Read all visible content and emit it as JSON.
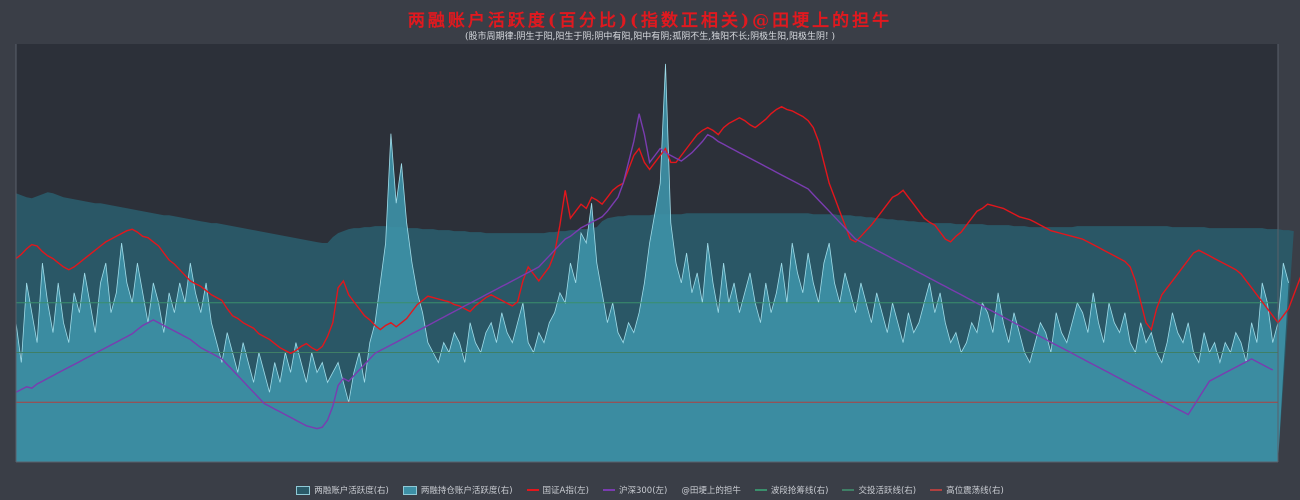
{
  "chart_data": {
    "type": "line",
    "title": "两融账户活跃度(百分比)(指数正相关)@田埂上的担牛",
    "subtitle": "(股市周期律:阴生于阳,阳生于阴;阴中有阳,阳中有阴;孤阴不生,独阳不长;阴极生阳,阳极生阴! )",
    "xlabel": "",
    "ylabel": "",
    "grid": false,
    "legend_position": "bottom",
    "x_points": 240,
    "series": [
      {
        "name": "两融账户活跃度(右)",
        "axis": "right",
        "kind": "area",
        "color": "#2a5a68",
        "values": [
          27.0,
          26.8,
          26.6,
          26.5,
          26.7,
          26.9,
          27.1,
          27.0,
          26.8,
          26.6,
          26.5,
          26.4,
          26.3,
          26.2,
          26.1,
          26.0,
          26.0,
          25.9,
          25.8,
          25.7,
          25.6,
          25.5,
          25.4,
          25.3,
          25.2,
          25.1,
          25.0,
          24.9,
          24.8,
          24.8,
          24.7,
          24.6,
          24.5,
          24.4,
          24.3,
          24.2,
          24.1,
          24.0,
          24.0,
          23.9,
          23.8,
          23.7,
          23.6,
          23.5,
          23.4,
          23.3,
          23.2,
          23.1,
          23.0,
          22.9,
          22.8,
          22.7,
          22.6,
          22.5,
          22.4,
          22.3,
          22.2,
          22.1,
          22.0,
          22.0,
          22.6,
          23.0,
          23.2,
          23.4,
          23.5,
          23.5,
          23.6,
          23.6,
          23.7,
          23.7,
          23.7,
          23.6,
          23.6,
          23.6,
          23.5,
          23.5,
          23.5,
          23.4,
          23.4,
          23.4,
          23.3,
          23.3,
          23.3,
          23.2,
          23.2,
          23.2,
          23.1,
          23.1,
          23.1,
          23.0,
          23.0,
          23.0,
          23.0,
          23.0,
          23.0,
          23.0,
          23.0,
          23.0,
          23.0,
          23.0,
          23.0,
          23.1,
          23.1,
          23.2,
          23.2,
          23.3,
          23.3,
          23.4,
          23.4,
          23.5,
          23.6,
          24.2,
          24.5,
          24.6,
          24.7,
          24.7,
          24.8,
          24.8,
          24.8,
          24.8,
          24.8,
          24.9,
          24.9,
          24.9,
          24.9,
          24.9,
          24.9,
          25.0,
          25.0,
          25.0,
          25.0,
          25.0,
          25.0,
          25.0,
          25.0,
          25.0,
          25.0,
          25.0,
          25.0,
          25.0,
          25.0,
          25.0,
          25.0,
          25.0,
          25.0,
          25.0,
          25.0,
          25.0,
          25.0,
          25.0,
          25.0,
          24.9,
          24.9,
          24.9,
          24.9,
          24.9,
          24.8,
          24.8,
          24.8,
          24.7,
          24.7,
          24.6,
          24.6,
          24.5,
          24.5,
          24.4,
          24.4,
          24.3,
          24.3,
          24.2,
          24.2,
          24.1,
          24.1,
          24.0,
          24.0,
          24.0,
          24.0,
          24.0,
          23.9,
          23.9,
          23.9,
          23.9,
          23.9,
          23.9,
          23.8,
          23.8,
          23.8,
          23.8,
          23.8,
          23.7,
          23.7,
          23.7,
          23.6,
          23.6,
          23.6,
          23.6,
          23.6,
          23.6,
          23.6,
          23.6,
          23.6,
          23.7,
          23.7,
          23.7,
          23.7,
          23.7,
          23.7,
          23.7,
          23.7,
          23.7,
          23.7,
          23.7,
          23.7,
          23.7,
          23.7,
          23.7,
          23.7,
          23.7,
          23.7,
          23.6,
          23.6,
          23.6,
          23.6,
          23.6,
          23.6,
          23.6,
          23.5,
          23.5,
          23.5,
          23.5,
          23.5,
          23.5,
          23.5,
          23.5,
          23.5,
          23.5,
          23.5,
          23.4,
          23.4,
          23.4,
          23.3,
          23.3,
          23.2
        ]
      },
      {
        "name": "两融持仓账户活跃度(右)",
        "axis": "right",
        "kind": "area",
        "color": "#3d90a6",
        "values": [
          14.0,
          10.0,
          18.0,
          15.0,
          12.0,
          20.0,
          16.0,
          13.0,
          18.0,
          14.0,
          12.0,
          17.0,
          15.0,
          19.0,
          16.0,
          13.0,
          18.0,
          20.0,
          15.0,
          17.0,
          22.0,
          18.0,
          16.0,
          20.0,
          17.0,
          14.0,
          18.0,
          16.0,
          13.0,
          17.0,
          15.0,
          18.0,
          16.0,
          20.0,
          17.0,
          15.0,
          18.0,
          14.0,
          12.0,
          10.0,
          13.0,
          11.0,
          9.0,
          12.0,
          10.0,
          8.0,
          11.0,
          9.0,
          7.0,
          10.0,
          8.0,
          11.0,
          9.0,
          12.0,
          10.0,
          8.0,
          11.0,
          9.0,
          10.0,
          8.0,
          9.0,
          10.0,
          8.0,
          6.0,
          9.0,
          11.0,
          8.0,
          12.0,
          14.0,
          18.0,
          22.0,
          33.0,
          26.0,
          30.0,
          24.0,
          20.0,
          17.0,
          15.0,
          12.0,
          11.0,
          10.0,
          12.0,
          11.0,
          13.0,
          12.0,
          10.0,
          14.0,
          12.0,
          11.0,
          13.0,
          14.0,
          12.0,
          15.0,
          13.0,
          12.0,
          14.0,
          16.0,
          12.0,
          11.0,
          13.0,
          12.0,
          14.0,
          15.0,
          17.0,
          16.0,
          20.0,
          18.0,
          23.0,
          22.0,
          26.0,
          20.0,
          17.0,
          14.0,
          16.0,
          13.0,
          12.0,
          14.0,
          13.0,
          15.0,
          18.0,
          22.0,
          25.0,
          28.0,
          40.0,
          24.0,
          20.0,
          18.0,
          21.0,
          17.0,
          19.0,
          16.0,
          22.0,
          18.0,
          15.0,
          20.0,
          16.0,
          18.0,
          15.0,
          17.0,
          19.0,
          16.0,
          14.0,
          18.0,
          15.0,
          17.0,
          20.0,
          16.0,
          22.0,
          19.0,
          17.0,
          21.0,
          18.0,
          16.0,
          20.0,
          22.0,
          18.0,
          16.0,
          19.0,
          17.0,
          15.0,
          18.0,
          16.0,
          14.0,
          17.0,
          15.0,
          13.0,
          16.0,
          14.0,
          12.0,
          15.0,
          13.0,
          14.0,
          16.0,
          18.0,
          15.0,
          17.0,
          14.0,
          12.0,
          13.0,
          11.0,
          12.0,
          14.0,
          13.0,
          16.0,
          15.0,
          13.0,
          17.0,
          14.0,
          12.0,
          15.0,
          13.0,
          11.0,
          10.0,
          12.0,
          14.0,
          13.0,
          11.0,
          15.0,
          13.0,
          12.0,
          14.0,
          16.0,
          15.0,
          13.0,
          17.0,
          14.0,
          12.0,
          16.0,
          14.0,
          13.0,
          15.0,
          12.0,
          11.0,
          14.0,
          12.0,
          13.0,
          11.0,
          10.0,
          12.0,
          15.0,
          13.0,
          12.0,
          14.0,
          11.0,
          10.0,
          13.0,
          11.0,
          12.0,
          10.0,
          12.0,
          11.0,
          13.0,
          12.0,
          10.0,
          14.0,
          12.0,
          18.0,
          16.0,
          12.0,
          14.0,
          20.0,
          18.0
        ]
      },
      {
        "name": "国证A指(左)",
        "axis": "left",
        "kind": "line",
        "color": "#e3161c",
        "values": [
          3260,
          3290,
          3330,
          3360,
          3350,
          3310,
          3280,
          3260,
          3230,
          3200,
          3180,
          3200,
          3230,
          3260,
          3290,
          3320,
          3350,
          3380,
          3400,
          3420,
          3440,
          3460,
          3470,
          3450,
          3420,
          3410,
          3380,
          3350,
          3300,
          3250,
          3220,
          3180,
          3140,
          3100,
          3080,
          3060,
          3030,
          3000,
          2980,
          2960,
          2900,
          2850,
          2830,
          2800,
          2780,
          2760,
          2720,
          2700,
          2680,
          2650,
          2620,
          2600,
          2580,
          2600,
          2630,
          2650,
          2620,
          2600,
          2630,
          2700,
          2800,
          3050,
          3100,
          3000,
          2950,
          2900,
          2850,
          2820,
          2780,
          2750,
          2780,
          2800,
          2770,
          2800,
          2830,
          2880,
          2930,
          2960,
          2990,
          2980,
          2970,
          2960,
          2950,
          2930,
          2920,
          2900,
          2880,
          2920,
          2950,
          2980,
          3000,
          2980,
          2960,
          2940,
          2920,
          2950,
          3100,
          3200,
          3150,
          3100,
          3150,
          3200,
          3300,
          3500,
          3750,
          3550,
          3600,
          3650,
          3620,
          3700,
          3680,
          3650,
          3700,
          3750,
          3780,
          3800,
          3900,
          4000,
          4050,
          3950,
          3900,
          3950,
          4000,
          4050,
          3950,
          3950,
          4000,
          4050,
          4100,
          4150,
          4180,
          4200,
          4180,
          4150,
          4200,
          4230,
          4250,
          4270,
          4250,
          4220,
          4200,
          4230,
          4260,
          4300,
          4330,
          4350,
          4330,
          4320,
          4300,
          4280,
          4250,
          4200,
          4100,
          3950,
          3800,
          3700,
          3600,
          3500,
          3400,
          3380,
          3420,
          3460,
          3500,
          3550,
          3600,
          3650,
          3700,
          3720,
          3750,
          3700,
          3650,
          3600,
          3550,
          3520,
          3500,
          3450,
          3400,
          3380,
          3420,
          3450,
          3500,
          3550,
          3600,
          3620,
          3650,
          3640,
          3630,
          3620,
          3600,
          3580,
          3560,
          3550,
          3540,
          3520,
          3500,
          3480,
          3460,
          3450,
          3440,
          3430,
          3420,
          3410,
          3400,
          3380,
          3360,
          3340,
          3320,
          3300,
          3280,
          3260,
          3240,
          3200,
          3100,
          2950,
          2800,
          2750,
          2900,
          3000,
          3050,
          3100,
          3150,
          3200,
          3250,
          3300,
          3320,
          3300,
          3280,
          3260,
          3240,
          3220,
          3200,
          3180,
          3150,
          3100,
          3050,
          3000,
          2950,
          2900,
          2850,
          2800,
          2850,
          2900,
          3000,
          3100,
          3200,
          3300,
          3350,
          3300
        ]
      },
      {
        "name": "沪深300(左)",
        "axis": "left",
        "kind": "line",
        "color": "#7a3cb0",
        "values": [
          2300,
          2320,
          2340,
          2330,
          2360,
          2380,
          2400,
          2420,
          2440,
          2460,
          2480,
          2500,
          2520,
          2540,
          2560,
          2580,
          2600,
          2620,
          2640,
          2660,
          2680,
          2700,
          2720,
          2750,
          2780,
          2800,
          2820,
          2800,
          2780,
          2760,
          2740,
          2720,
          2700,
          2680,
          2650,
          2620,
          2600,
          2580,
          2560,
          2540,
          2500,
          2460,
          2420,
          2380,
          2340,
          2300,
          2260,
          2220,
          2200,
          2180,
          2160,
          2140,
          2120,
          2100,
          2080,
          2060,
          2050,
          2040,
          2050,
          2100,
          2200,
          2350,
          2400,
          2380,
          2420,
          2460,
          2500,
          2540,
          2580,
          2600,
          2620,
          2640,
          2660,
          2680,
          2700,
          2720,
          2740,
          2760,
          2780,
          2800,
          2820,
          2840,
          2860,
          2880,
          2900,
          2920,
          2940,
          2960,
          2980,
          3000,
          3020,
          3040,
          3060,
          3080,
          3100,
          3120,
          3140,
          3160,
          3180,
          3200,
          3240,
          3280,
          3320,
          3360,
          3400,
          3420,
          3450,
          3480,
          3500,
          3520,
          3540,
          3560,
          3600,
          3650,
          3700,
          3800,
          3950,
          4100,
          4300,
          4150,
          3950,
          4000,
          4050,
          4020,
          4000,
          3980,
          3960,
          3990,
          4020,
          4060,
          4100,
          4150,
          4130,
          4100,
          4080,
          4060,
          4040,
          4020,
          4000,
          3980,
          3960,
          3940,
          3920,
          3900,
          3880,
          3860,
          3840,
          3820,
          3800,
          3780,
          3760,
          3720,
          3680,
          3640,
          3600,
          3560,
          3520,
          3480,
          3440,
          3400,
          3380,
          3360,
          3340,
          3320,
          3300,
          3280,
          3260,
          3240,
          3220,
          3200,
          3180,
          3160,
          3140,
          3120,
          3100,
          3080,
          3060,
          3040,
          3020,
          3000,
          2980,
          2960,
          2940,
          2920,
          2900,
          2880,
          2860,
          2840,
          2820,
          2800,
          2780,
          2760,
          2740,
          2720,
          2700,
          2680,
          2660,
          2640,
          2620,
          2600,
          2580,
          2560,
          2540,
          2520,
          2500,
          2480,
          2460,
          2440,
          2420,
          2400,
          2380,
          2360,
          2340,
          2320,
          2300,
          2280,
          2260,
          2240,
          2220,
          2200,
          2180,
          2160,
          2140,
          2200,
          2260,
          2320,
          2380,
          2400,
          2420,
          2440,
          2460,
          2480,
          2500,
          2520,
          2540,
          2520,
          2500,
          2480,
          2460
        ]
      }
    ],
    "reference_lines": [
      {
        "name": "波段抢筹线(右)",
        "axis": "right",
        "value": 16.0,
        "color": "#3a8f6c"
      },
      {
        "name": "交投活跃线(右)",
        "axis": "right",
        "value": 11.0,
        "color": "#3f7f66"
      },
      {
        "name": "高位震荡线(右)",
        "axis": "right",
        "value": 6.0,
        "color": "#b04040"
      }
    ],
    "axes": {
      "left": {
        "ylim": [
          1800,
          4800
        ]
      },
      "right": {
        "ylim": [
          0,
          42
        ]
      }
    },
    "legend": [
      {
        "label": "两融账户活跃度(右)",
        "color": "#2a5a68",
        "style": "box"
      },
      {
        "label": "两融持仓账户活跃度(右)",
        "color": "#3d90a6",
        "style": "box"
      },
      {
        "label": "国证A指(左)",
        "color": "#e3161c",
        "style": "line"
      },
      {
        "label": "沪深300(左)",
        "color": "#7a3cb0",
        "style": "line"
      },
      {
        "label": "@田埂上的担牛",
        "color": "",
        "style": "none"
      },
      {
        "label": "波段抢筹线(右)",
        "color": "#3a8f6c",
        "style": "line"
      },
      {
        "label": "交投活跃线(右)",
        "color": "#3f7f66",
        "style": "line"
      },
      {
        "label": "高位震荡线(右)",
        "color": "#b04040",
        "style": "line"
      }
    ]
  }
}
